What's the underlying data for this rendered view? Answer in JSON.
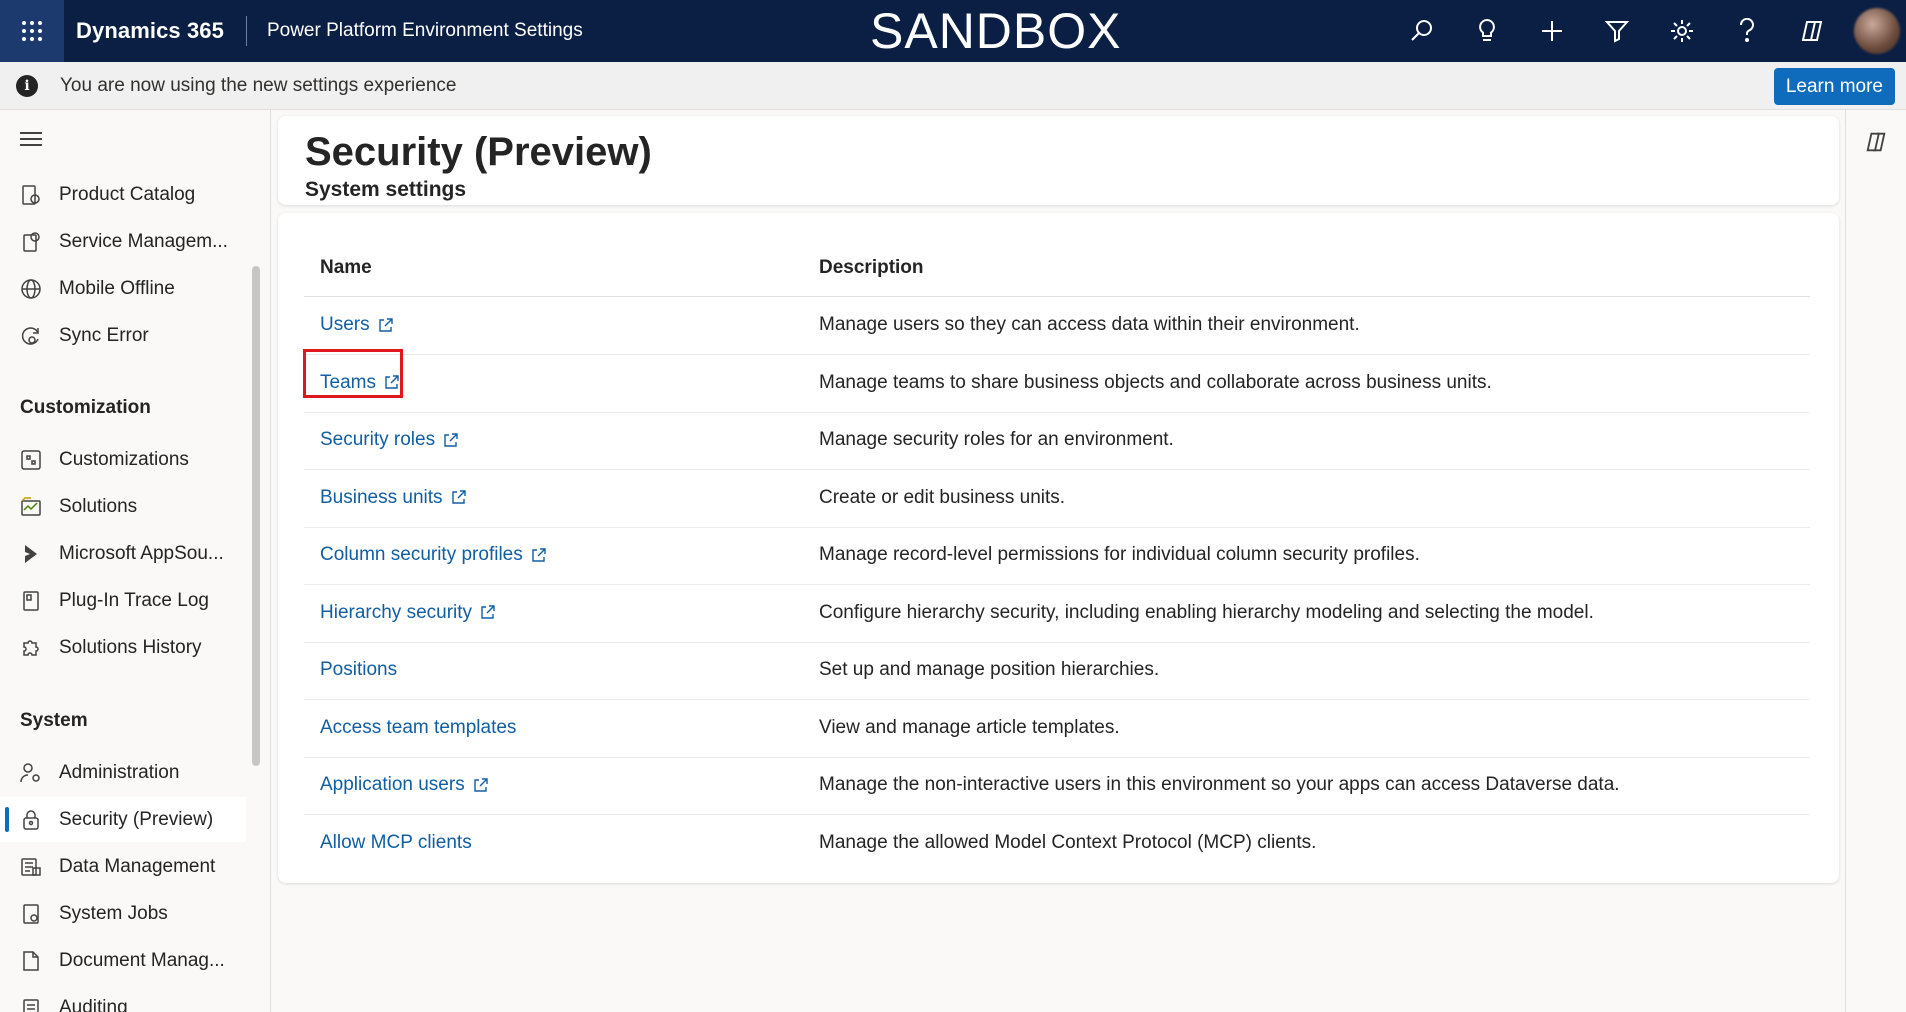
{
  "topbar": {
    "app_name": "Dynamics 365",
    "area_name": "Power Platform Environment Settings",
    "environment_label": "SANDBOX",
    "icons": [
      "search-icon",
      "lightbulb-icon",
      "plus-icon",
      "filter-icon",
      "gear-icon",
      "help-icon",
      "copilot-icon"
    ],
    "background_color": "#0b1f44"
  },
  "notice": {
    "icon": "info-icon",
    "text": "You are now using the new settings experience",
    "button_label": "Learn more"
  },
  "sidebar": {
    "items_top": [
      {
        "label": "Product Catalog",
        "icon": "product-catalog-icon"
      },
      {
        "label": "Service Managem...",
        "icon": "service-management-icon"
      },
      {
        "label": "Mobile Offline",
        "icon": "globe-icon"
      },
      {
        "label": "Sync Error",
        "icon": "sync-error-icon"
      }
    ],
    "customization_header": "Customization",
    "items_customization": [
      {
        "label": "Customizations",
        "icon": "customizations-icon"
      },
      {
        "label": "Solutions",
        "icon": "solutions-icon"
      },
      {
        "label": "Microsoft AppSou...",
        "icon": "appsource-icon"
      },
      {
        "label": "Plug-In Trace Log",
        "icon": "trace-log-icon"
      },
      {
        "label": "Solutions History",
        "icon": "puzzle-icon"
      }
    ],
    "system_header": "System",
    "items_system": [
      {
        "label": "Administration",
        "icon": "administration-icon"
      },
      {
        "label": "Security (Preview)",
        "icon": "lock-icon",
        "active": true
      },
      {
        "label": "Data Management",
        "icon": "data-management-icon"
      },
      {
        "label": "System Jobs",
        "icon": "system-jobs-icon"
      },
      {
        "label": "Document Manag...",
        "icon": "document-management-icon"
      },
      {
        "label": "Auditing",
        "icon": "auditing-icon"
      }
    ]
  },
  "page": {
    "title": "Security (Preview)",
    "subtitle": "System settings"
  },
  "table": {
    "columns": [
      "Name",
      "Description"
    ],
    "rows": [
      {
        "name": "Users",
        "external": true,
        "description": "Manage users so they can access data within their environment."
      },
      {
        "name": "Teams",
        "external": true,
        "description": "Manage teams to share business objects and collaborate across business units.",
        "highlighted": true
      },
      {
        "name": "Security roles",
        "external": true,
        "description": "Manage security roles for an environment."
      },
      {
        "name": "Business units",
        "external": true,
        "description": "Create or edit business units."
      },
      {
        "name": "Column security profiles",
        "external": true,
        "description": "Manage record-level permissions for individual column security profiles."
      },
      {
        "name": "Hierarchy security",
        "external": true,
        "description": "Configure hierarchy security, including enabling hierarchy modeling and selecting the model."
      },
      {
        "name": "Positions",
        "external": false,
        "description": "Set up and manage position hierarchies."
      },
      {
        "name": "Access team templates",
        "external": false,
        "description": "View and manage article templates."
      },
      {
        "name": "Application users",
        "external": true,
        "description": "Manage the non-interactive users in this environment so your apps can access Dataverse data."
      },
      {
        "name": "Allow MCP clients",
        "external": false,
        "description": "Manage the allowed Model Context Protocol (MCP) clients."
      }
    ]
  },
  "colors": {
    "accent": "#0f6cbd",
    "link": "#115ea3",
    "highlight_box": "#e0171f"
  }
}
